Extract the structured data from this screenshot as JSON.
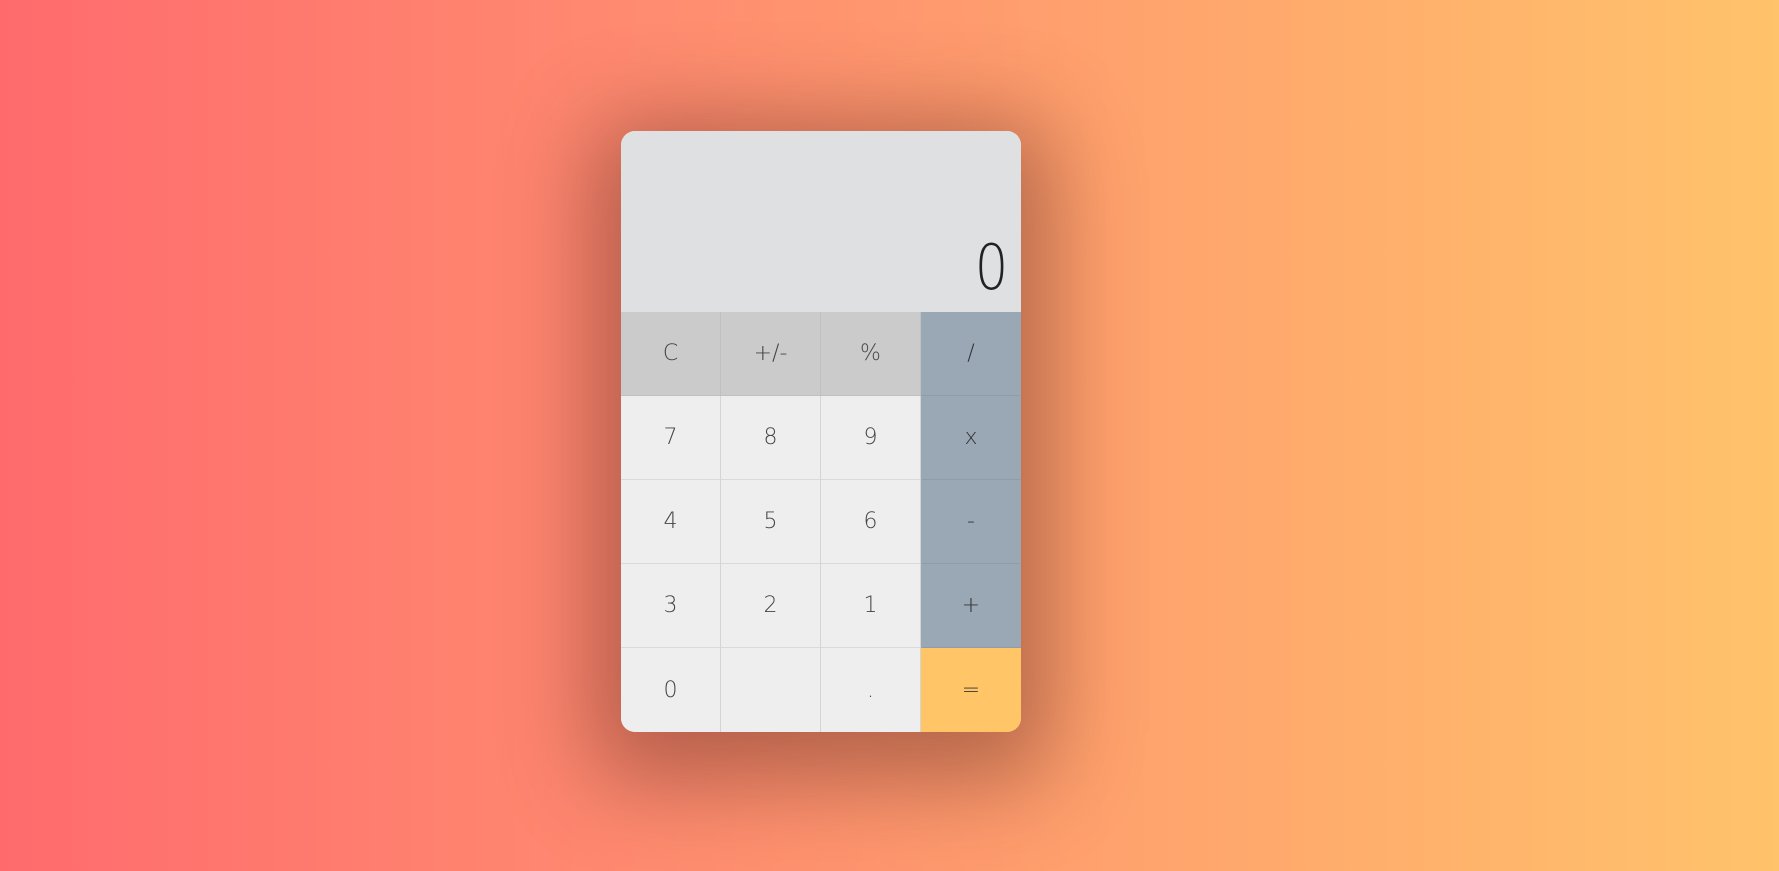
{
  "display": {
    "value": "0"
  },
  "keys": {
    "row1": [
      "C",
      "+/-",
      "%",
      "/"
    ],
    "row2": [
      "7",
      "8",
      "9",
      "x"
    ],
    "row3": [
      "4",
      "5",
      "6",
      "-"
    ],
    "row4": [
      "3",
      "2",
      "1",
      "+"
    ],
    "row5": [
      "0",
      "",
      ".",
      "="
    ]
  },
  "colors": {
    "background_left": "#ff6b6d",
    "background_right": "#ffc36b",
    "display_bg": "#dfe0e2",
    "function_key_bg": "#cbcbcb",
    "number_key_bg": "#eeeeee",
    "operator_key_bg": "#9aa8b6",
    "equals_key_bg": "#ffc566"
  }
}
